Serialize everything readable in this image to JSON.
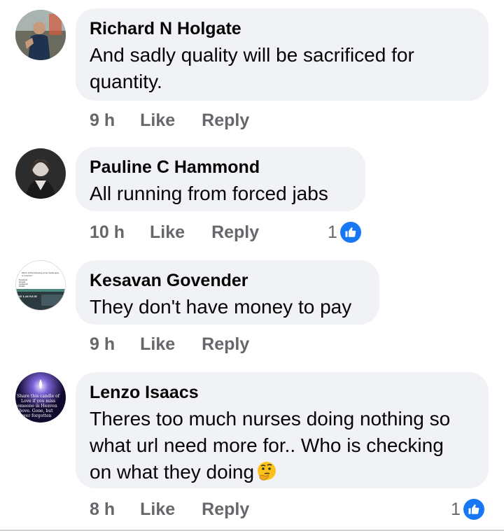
{
  "comments": [
    {
      "author": "Richard N Holgate",
      "lines": [
        "And sadly quality will be sacrificed for",
        "quantity."
      ],
      "time": "9 h",
      "like_label": "Like",
      "reply_label": "Reply",
      "avatar": "profile-photo-icon",
      "reaction_count": null
    },
    {
      "author": "Pauline C Hammond",
      "lines": [
        "All running from forced jabs"
      ],
      "time": "10 h",
      "like_label": "Like",
      "reply_label": "Reply",
      "avatar": "profile-photo-icon",
      "reaction_count": "1"
    },
    {
      "author": "Kesavan Govender",
      "lines": [
        "They don't have money to pay"
      ],
      "time": "9 h",
      "like_label": "Like",
      "reply_label": "Reply",
      "avatar": "screenshot-avatar-icon",
      "reaction_count": null
    },
    {
      "author": "Lenzo Isaacs",
      "lines": [
        "Theres too much nurses doing nothing so",
        "what url need more for.. Who is checking",
        "on what they doing"
      ],
      "emoji": "thinking-face-icon",
      "time": "8 h",
      "like_label": "Like",
      "reply_label": "Reply",
      "avatar": "candle-avatar-icon",
      "reaction_count": "1"
    }
  ],
  "avatar_text": {
    "kesavan": [
      "Which of the following social media apps",
      "is common?",
      "Facebook",
      "Google",
      "Instagram",
      "Twitter",
      "RE LAUNCH"
    ],
    "lenzo": [
      "Share this candle of",
      "Love if you miss",
      "someone in Heaven",
      "above. Gone, but",
      "never forgotten"
    ]
  },
  "colors": {
    "bubble": "#f0f2f5",
    "text": "#050505",
    "meta": "#65676b",
    "like_blue": "#1877f2"
  }
}
